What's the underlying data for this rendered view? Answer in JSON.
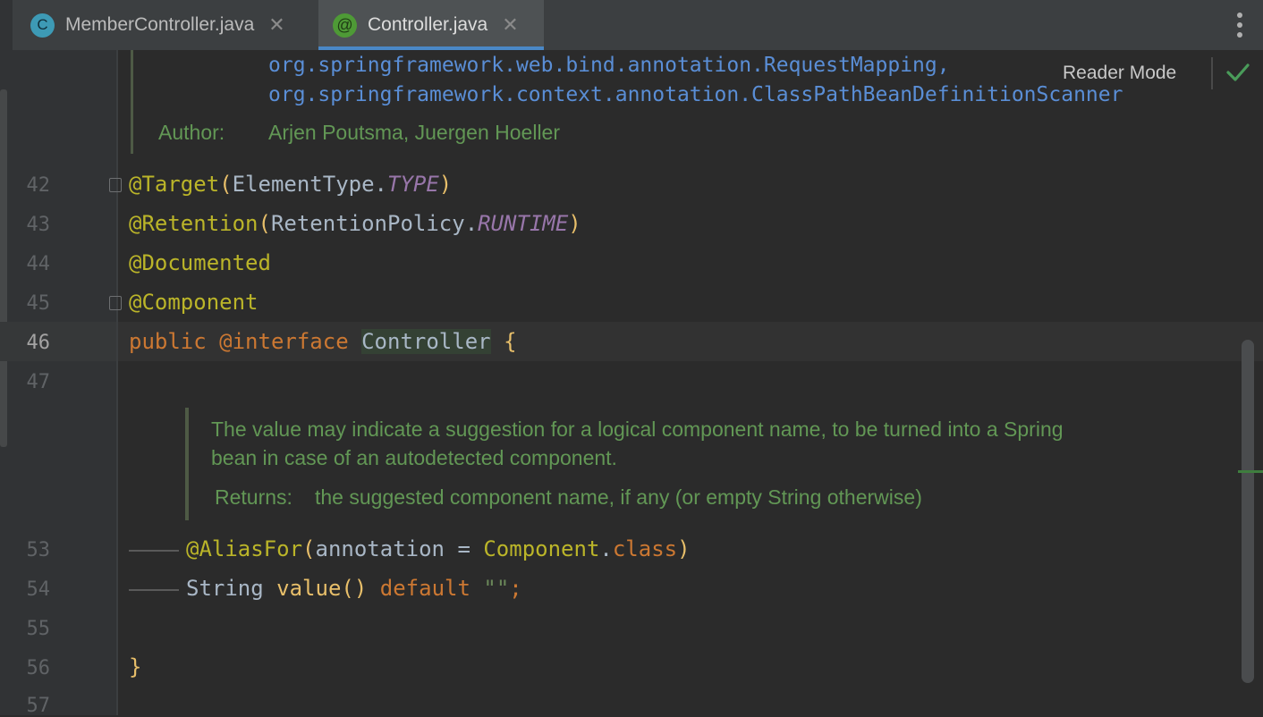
{
  "tabs": [
    {
      "icon_letter": "C",
      "icon": "class-icon",
      "label": "MemberController.java",
      "active": false
    },
    {
      "icon_letter": "@",
      "icon": "annotation-icon",
      "label": "Controller.java",
      "active": true
    }
  ],
  "editor": {
    "reader_mode_label": "Reader Mode",
    "doc_top": {
      "ref1": "org.springframework.web.bind.annotation.RequestMapping,",
      "ref2": "org.springframework.context.annotation.ClassPathBeanDefinitionScanner",
      "author_label": "Author:",
      "author_value": "Arjen Poutsma, Juergen Hoeller"
    },
    "line_numbers": [
      "42",
      "43",
      "44",
      "45",
      "46",
      "47",
      "53",
      "54",
      "55",
      "56",
      "57"
    ],
    "current_line": "46",
    "lines": {
      "l42": {
        "ann": "@Target",
        "open": "(",
        "cls": "ElementType.",
        "ital": "TYPE",
        "close": ")"
      },
      "l43": {
        "ann": "@Retention",
        "open": "(",
        "cls": "RetentionPolicy.",
        "ital": "RUNTIME",
        "close": ")"
      },
      "l44": {
        "ann": "@Documented"
      },
      "l45": {
        "ann": "@Component"
      },
      "l46": {
        "kw1": "public",
        "kw2": "@interface",
        "name": "Controller",
        "brace": "{"
      },
      "l53": {
        "ann": "@AliasFor",
        "open": "(",
        "param": "annotation",
        "eq": " = ",
        "cls": "Component",
        "dot": ".",
        "kw": "class",
        "close": ")"
      },
      "l54": {
        "type": "String",
        "method": "value",
        "parens": "()",
        "kw": "default",
        "str": "\"\"",
        "semi": ";"
      },
      "l56": {
        "brace": "}"
      }
    },
    "doc_inner": {
      "text1": "The value may indicate a suggestion for a logical component name, to be turned into a Spring",
      "text2": "bean in case of an autodetected component.",
      "returns_label": "Returns:",
      "returns_value": "the suggested component name, if any (or empty String otherwise)"
    }
  }
}
